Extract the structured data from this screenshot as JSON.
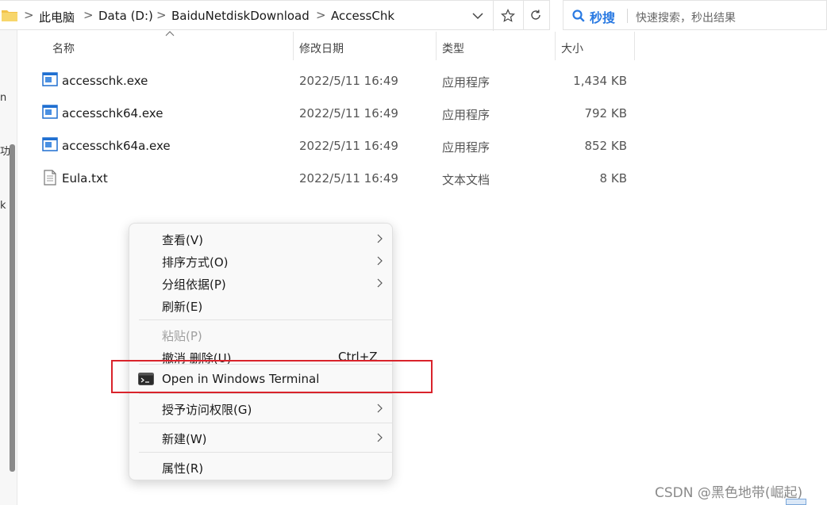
{
  "address": {
    "segments": [
      "此电脑",
      "Data (D:)",
      "BaiduNetdiskDownload",
      "AccessChk"
    ],
    "separator": ">"
  },
  "search": {
    "brand": "秒搜",
    "placeholder": "快速搜索，秒出结果"
  },
  "columns": {
    "name": "名称",
    "date": "修改日期",
    "type": "类型",
    "size": "大小"
  },
  "files": [
    {
      "name": "accesschk.exe",
      "date": "2022/5/11 16:49",
      "type": "应用程序",
      "size": "1,434 KB",
      "icon": "exe-icon"
    },
    {
      "name": "accesschk64.exe",
      "date": "2022/5/11 16:49",
      "type": "应用程序",
      "size": "792 KB",
      "icon": "exe-icon"
    },
    {
      "name": "accesschk64a.exe",
      "date": "2022/5/11 16:49",
      "type": "应用程序",
      "size": "852 KB",
      "icon": "exe-icon"
    },
    {
      "name": "Eula.txt",
      "date": "2022/5/11 16:49",
      "type": "文本文档",
      "size": "8 KB",
      "icon": "text-file-icon"
    }
  ],
  "left_edge_chars": [
    "n",
    "功",
    "k"
  ],
  "context_menu": {
    "view": "查看(V)",
    "sort": "排序方式(O)",
    "group": "分组依据(P)",
    "refresh": "刷新(E)",
    "paste": "粘贴(P)",
    "undo": "撤消 删除(U)",
    "undo_shortcut": "Ctrl+Z",
    "terminal": "Open in Windows Terminal",
    "grant": "授予访问权限(G)",
    "new": "新建(W)",
    "properties": "属性(R)"
  },
  "watermark": "CSDN @黑色地带(崛起)",
  "colors": {
    "highlight_border": "#d9232b",
    "search_brand": "#2a7ae2",
    "exe_icon_blue": "#1f6fd1"
  }
}
